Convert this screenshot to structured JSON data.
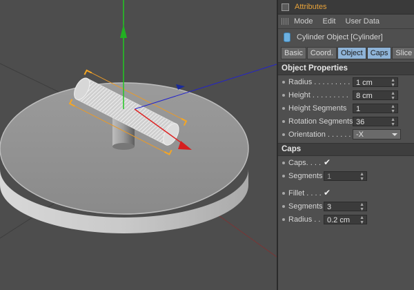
{
  "viewport": {
    "description_icon": "cylinder-3d-view"
  },
  "attributes": {
    "title": "Attributes",
    "menu": [
      "Mode",
      "Edit",
      "User Data"
    ],
    "object_title": "Cylinder Object [Cylinder]",
    "tabs": [
      "Basic",
      "Coord.",
      "Object",
      "Caps",
      "Slice"
    ],
    "active_tabs": [
      "Object",
      "Caps"
    ],
    "object_section": {
      "title": "Object Properties",
      "radius_label": "Radius . . . . . . . . .",
      "radius_value": "1 cm",
      "height_label": "Height . . . . . . . . .",
      "height_value": "8 cm",
      "height_segments_label": "Height Segments",
      "height_segments_value": "1",
      "rotation_segments_label": "Rotation Segments",
      "rotation_segments_value": "36",
      "orientation_label": "Orientation . . . . . .",
      "orientation_value": "-X"
    },
    "caps_section": {
      "title": "Caps",
      "caps_label": "Caps. . . .",
      "caps_checked": "✔",
      "segments_label": "Segments",
      "segments_value": "1",
      "fillet_label": "Fillet . . . .",
      "fillet_checked": "✔",
      "fillet_segments_label": "Segments",
      "fillet_segments_value": "3",
      "fillet_radius_label": "Radius . .",
      "fillet_radius_value": "0.2 cm"
    }
  },
  "colors": {
    "accent_title": "#e8a33a",
    "active_tab": "#8fb4d8",
    "x_axis": "#c81e1e",
    "y_axis": "#1ec81e",
    "z_axis": "#1e1ec8"
  }
}
